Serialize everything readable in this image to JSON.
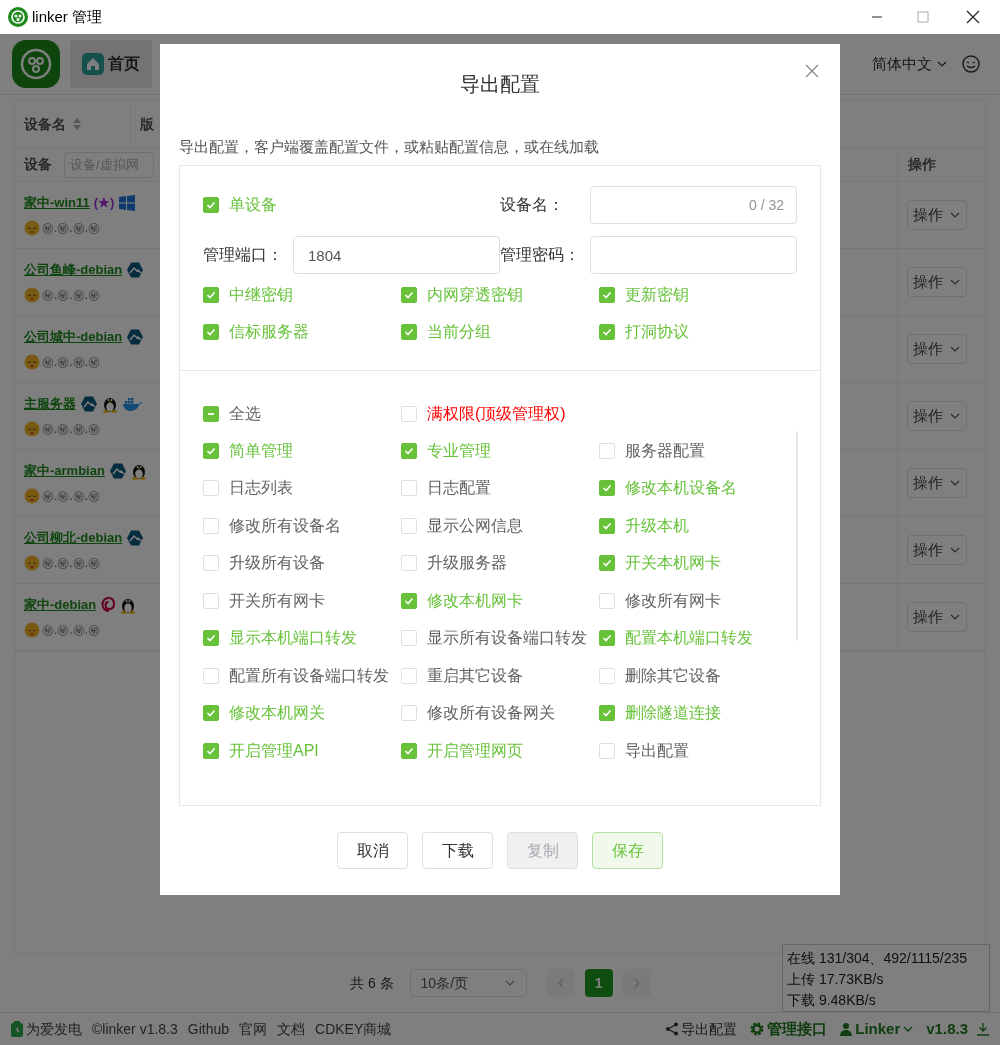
{
  "window": {
    "title": "linker 管理"
  },
  "header": {
    "home_tab": {
      "label": "首页",
      "selected": true
    },
    "language": "简体中文"
  },
  "table": {
    "columns": [
      {
        "label": "设备名",
        "sortable": true
      },
      {
        "label": "版",
        "sortable": false
      }
    ],
    "filter": {
      "label": "设备",
      "placeholder": "设备/虚拟网"
    },
    "action_column": "操作",
    "rows": [
      {
        "name": "家中-win11",
        "tag": "(★)",
        "os_icons": [
          {
            "kind": "windows"
          }
        ],
        "ip": "㊙.㊙.㊙.㊙",
        "action": "操作"
      },
      {
        "name": "公司鱼峰-debian",
        "os_icons": [
          {
            "kind": "alpine"
          }
        ],
        "ip": "㊙.㊙.㊙.㊙",
        "action": "操作"
      },
      {
        "name": "公司城中-debian",
        "os_icons": [
          {
            "kind": "alpine"
          }
        ],
        "ip": "㊙.㊙.㊙.㊙",
        "action": "操作"
      },
      {
        "name": "主服务器",
        "os_icons": [
          {
            "kind": "alpine"
          },
          {
            "kind": "linux"
          },
          {
            "kind": "docker"
          }
        ],
        "ip": "㊙.㊙.㊙.㊙",
        "action": "操作"
      },
      {
        "name": "家中-armbian",
        "os_icons": [
          {
            "kind": "alpine"
          },
          {
            "kind": "linux"
          }
        ],
        "ip": "㊙.㊙.㊙.㊙",
        "action": "操作"
      },
      {
        "name": "公司柳北-debian",
        "os_icons": [
          {
            "kind": "alpine"
          }
        ],
        "ip": "㊙.㊙.㊙.㊙",
        "action": "操作"
      },
      {
        "name": "家中-debian",
        "os_icons": [
          {
            "kind": "debian"
          },
          {
            "kind": "linux"
          }
        ],
        "ip": "㊙.㊙.㊙.㊙",
        "action": "操作"
      }
    ]
  },
  "pagination": {
    "total": "共 6 条",
    "page_size": "10条/页",
    "pages": [
      {
        "label": "1",
        "selected": true
      }
    ]
  },
  "status": [
    "在线 131/304、492/1115/235",
    "上传 17.73KB/s",
    "下载 9.48KB/s"
  ],
  "footer": {
    "left": [
      "为爱发电",
      "©linker v1.8.3",
      "Github",
      "官网",
      "文档",
      "CDKEY商城"
    ],
    "right": [
      {
        "kind": "share",
        "label": "导出配置"
      },
      {
        "kind": "gear",
        "label": "管理接口"
      },
      {
        "kind": "user",
        "label": "Linker"
      },
      {
        "kind": "download",
        "label": "v1.8.3"
      }
    ]
  },
  "dialog": {
    "title": "导出配置",
    "description": "导出配置，客户端覆盖配置文件，或粘贴配置信息，或在线加载",
    "single_device": {
      "label": "单设备",
      "checked": true
    },
    "device_name": {
      "label": "设备名：",
      "counter": "0 / 32"
    },
    "port": {
      "label": "管理端口：",
      "value": "1804"
    },
    "password": {
      "label": "管理密码："
    },
    "options": [
      {
        "label": "中继密钥",
        "checked": true
      },
      {
        "label": "内网穿透密钥",
        "checked": true
      },
      {
        "label": "更新密钥",
        "checked": true
      },
      {
        "label": "信标服务器",
        "checked": true
      },
      {
        "label": "当前分组",
        "checked": true
      },
      {
        "label": "打洞协议",
        "checked": true
      }
    ],
    "select_all": {
      "label": "全选",
      "indeterminate": true
    },
    "full_permission": {
      "label": "满权限(顶级管理权)",
      "checked": false
    },
    "permissions": [
      {
        "label": "简单管理",
        "checked": true
      },
      {
        "label": "专业管理",
        "checked": true
      },
      {
        "label": "服务器配置",
        "checked": false
      },
      {
        "label": "日志列表",
        "checked": false
      },
      {
        "label": "日志配置",
        "checked": false
      },
      {
        "label": "修改本机设备名",
        "checked": true
      },
      {
        "label": "修改所有设备名",
        "checked": false
      },
      {
        "label": "显示公网信息",
        "checked": false
      },
      {
        "label": "升级本机",
        "checked": true
      },
      {
        "label": "升级所有设备",
        "checked": false
      },
      {
        "label": "升级服务器",
        "checked": false
      },
      {
        "label": "开关本机网卡",
        "checked": true
      },
      {
        "label": "开关所有网卡",
        "checked": false
      },
      {
        "label": "修改本机网卡",
        "checked": true
      },
      {
        "label": "修改所有网卡",
        "checked": false
      },
      {
        "label": "显示本机端口转发",
        "checked": true
      },
      {
        "label": "显示所有设备端口转发",
        "checked": false
      },
      {
        "label": "配置本机端口转发",
        "checked": true
      },
      {
        "label": "配置所有设备端口转发",
        "checked": false
      },
      {
        "label": "重启其它设备",
        "checked": false
      },
      {
        "label": "删除其它设备",
        "checked": false
      },
      {
        "label": "修改本机网关",
        "checked": true
      },
      {
        "label": "修改所有设备网关",
        "checked": false
      },
      {
        "label": "删除隧道连接",
        "checked": true
      },
      {
        "label": "开启管理API",
        "checked": true
      },
      {
        "label": "开启管理网页",
        "checked": true
      },
      {
        "label": "导出配置",
        "checked": false
      }
    ],
    "buttons": [
      {
        "label": "取消",
        "kind": "plain",
        "disabled": false
      },
      {
        "label": "下载",
        "kind": "plain",
        "disabled": false
      },
      {
        "label": "复制",
        "kind": "plain",
        "disabled": true
      },
      {
        "label": "保存",
        "kind": "success",
        "disabled": false
      }
    ]
  }
}
